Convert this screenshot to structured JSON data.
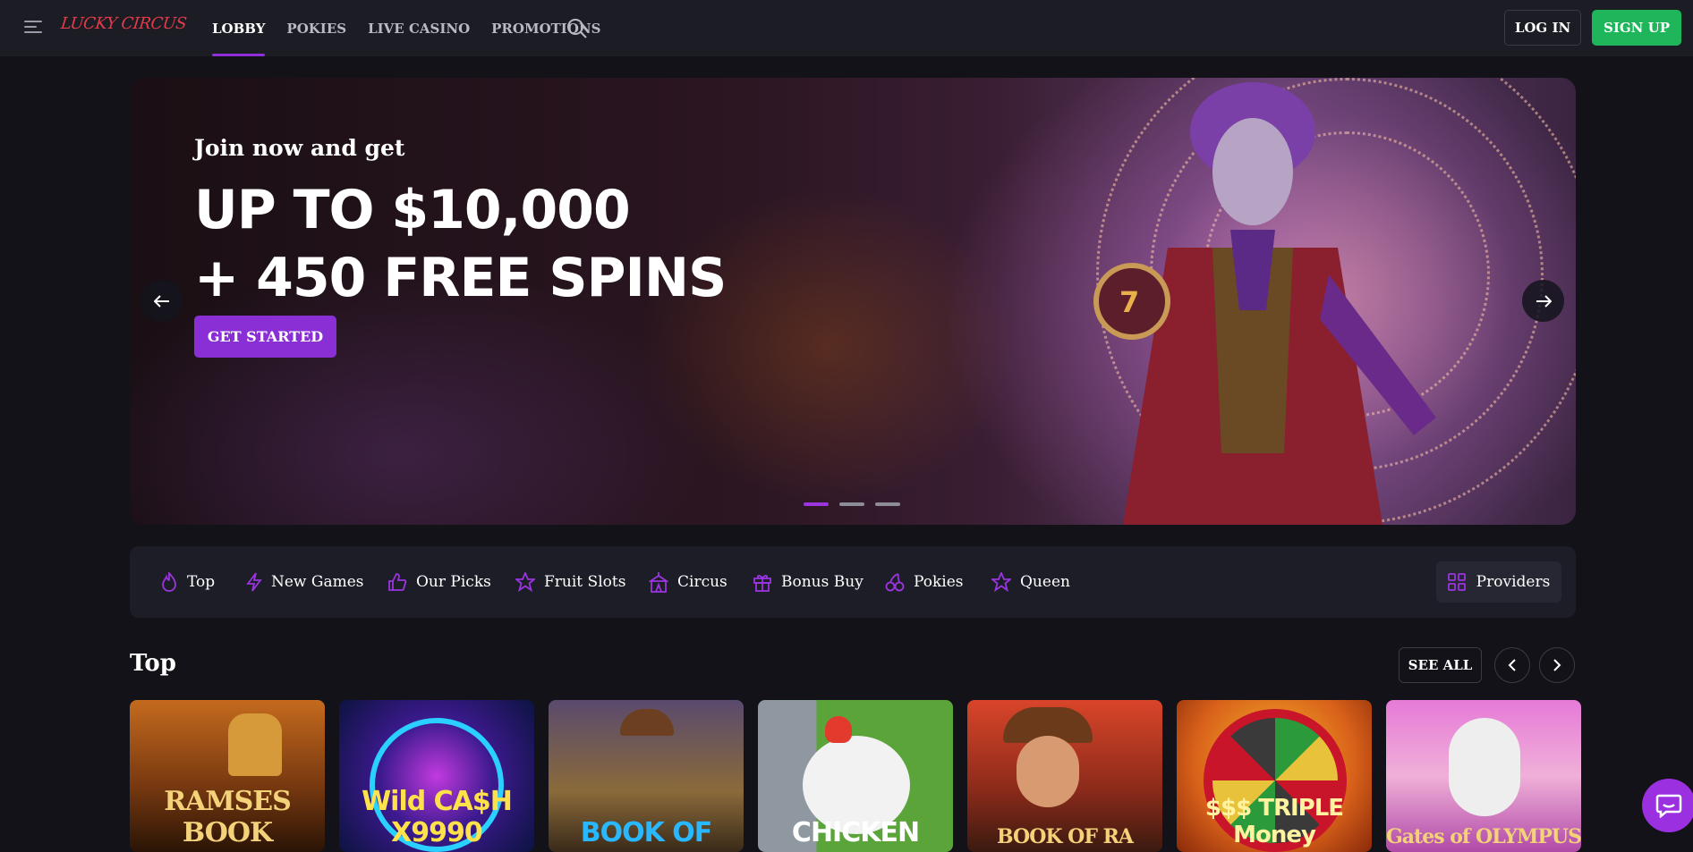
{
  "header": {
    "logo_text": "LUCKY CIRCUS",
    "nav": [
      "LOBBY",
      "POKIES",
      "LIVE CASINO",
      "PROMOTIONS"
    ],
    "login_label": "LOG IN",
    "signup_label": "SIGN UP"
  },
  "hero": {
    "subtitle": "Join now and get",
    "title_line1": "UP TO $10,000",
    "title_line2": "+ 450 FREE SPINS",
    "cta_label": "GET STARTED",
    "slide_count": 3,
    "active_slide": 1
  },
  "categories": {
    "items": [
      {
        "label": "Top",
        "icon": "flame-icon"
      },
      {
        "label": "New Games",
        "icon": "lightning-icon"
      },
      {
        "label": "Our Picks",
        "icon": "thumbs-up-icon"
      },
      {
        "label": "Fruit Slots",
        "icon": "star-icon"
      },
      {
        "label": "Circus",
        "icon": "circus-tent-icon"
      },
      {
        "label": "Bonus Buy",
        "icon": "gift-icon"
      },
      {
        "label": "Pokies",
        "icon": "cherries-icon"
      },
      {
        "label": "Queen",
        "icon": "star-icon"
      }
    ],
    "providers_label": "Providers"
  },
  "top_section": {
    "title": "Top",
    "see_all_label": "SEE ALL",
    "games": [
      {
        "label": "RAMSES BOOK"
      },
      {
        "label": "Wild CA$H X9990"
      },
      {
        "label": "BOOK OF"
      },
      {
        "label": "CHICKEN"
      },
      {
        "label": "BOOK OF RA"
      },
      {
        "label": "$$$ TRIPLE Money"
      },
      {
        "label": "Gates of OLYMPUS"
      }
    ]
  },
  "colors": {
    "accent_purple": "#8a2ed6",
    "signup_green": "#1fb55a",
    "background": "#121218",
    "panel": "#1c1d26"
  }
}
